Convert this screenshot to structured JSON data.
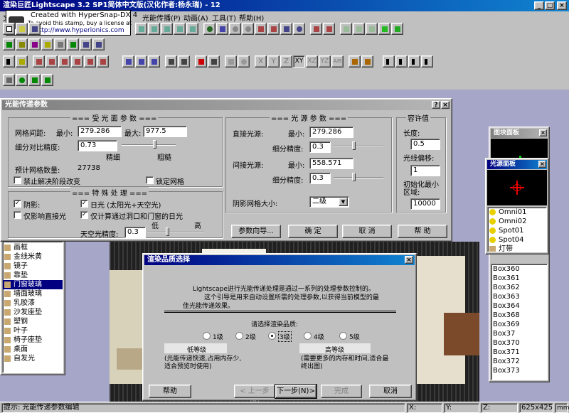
{
  "app": {
    "title": "渲染巨匠Lightscape 3.2 SP1简体中文版(汉化作者:杨永瑞) - 12"
  },
  "menu": {
    "file": "文",
    "lightprop": "光能传播(P)",
    "animation": "动画(A)",
    "tools": "工具(T)",
    "help": "帮助(H)"
  },
  "watermark": {
    "line1": "Created with HyperSnap-DX 4",
    "line2": "To avoid this stamp, buy a license at",
    "line3": "http://www.hyperionics.com"
  },
  "toolbar": {
    "x": "X",
    "y": "Y",
    "z": "Z",
    "xy": "XY",
    "xz": "XZ",
    "yz": "YZ",
    "ab": "A/B"
  },
  "param_dialog": {
    "title": "光能传递参数",
    "receive_section": "=== 受 光 面 参 数 ===",
    "mesh_spacing": "网格间距:",
    "min_label": "最小:",
    "min_value": "279.286",
    "max_label": "最大:",
    "max_value": "977.5",
    "subdiv_contrast": "细分对比精度:",
    "subdiv_value": "0.73",
    "fine": "精细",
    "coarse": "粗糙",
    "est_mesh": "预计网格数量:",
    "est_mesh_value": "27738",
    "disable_change": "禁止解决阶段改变",
    "lock_mesh": "锁定网格",
    "special_section": "=== 特 殊 处 理 ===",
    "shadow": "阴影:",
    "only_direct": "仅影响直接光",
    "daylight": "日光 (太阳光+天空光)",
    "only_windows": "仅计算通过洞口和门窗的日光",
    "low": "低",
    "high": "高",
    "sky_precision": "天空光精度:",
    "sky_value": "0.3",
    "source_section": "=== 光 源 参 数 ===",
    "direct_src": "直接光源:",
    "direct_min_label": "最小:",
    "direct_min": "279.286",
    "direct_subdiv_label": "细分精度:",
    "direct_subdiv": "0.3",
    "indirect_src": "间接光源:",
    "indirect_min_label": "最小:",
    "indirect_min": "558.571",
    "indirect_subdiv_label": "细分精度:",
    "indirect_subdiv": "0.3",
    "shadow_mesh": "阴影网格大小:",
    "shadow_mesh_value": "二级",
    "tolerance_section": "容许值",
    "length": "长度:",
    "length_value": "0.5",
    "ray_offset": "光线偏移:",
    "ray_offset_value": "1",
    "init_min": "初始化最小",
    "init_area": "区域:",
    "init_value": "10000",
    "wizard_btn": "参数向导...",
    "ok_btn": "确 定",
    "cancel_btn": "取 消",
    "help_btn": "帮 助"
  },
  "quality_dialog": {
    "title": "渲染品质选择",
    "intro1": "Lightscape进行光能传递处理是通过一系列的处理参数控制的。",
    "intro2": "这个引导是用来自动设置所需的处理参数,以获得当前模型的最",
    "intro3": "佳光能传递效果。",
    "prompt": "请选择渲染品质:",
    "levels": [
      "1级",
      "2级",
      "3级",
      "4级",
      "5级"
    ],
    "selected": "3级",
    "low_title": "低等级",
    "low_desc1": "(光能传递快速,占用内存少,",
    "low_desc2": "适合预览时使用)",
    "high_title": "高等级",
    "high_desc1": "(需要更多的内存和时间,适合最",
    "high_desc2": "终出图)",
    "help": "帮助",
    "back": "< 上一步(B)",
    "next": "下一步(N)>",
    "finish": "完成",
    "cancel": "取消"
  },
  "material_list": {
    "items": [
      "画框",
      "金线米黄",
      "镜子",
      "靠垫",
      "门窗玻璃",
      "墙面玻璃",
      "乳胶漆",
      "沙发座垫",
      "塑钢",
      "叶子",
      "椅子座垫",
      "桌面",
      "自发光"
    ],
    "selected": "门窗玻璃"
  },
  "block_panel": {
    "title": "图块面板",
    "items": [
      "Box360",
      "Box361",
      "Box362",
      "Box363",
      "Box364",
      "Box368",
      "Box369",
      "Box37",
      "Box370",
      "Box371",
      "Box372",
      "Box373"
    ]
  },
  "light_panel": {
    "title": "光源面板",
    "items": [
      "Omni01",
      "Omni02",
      "Spot01",
      "Spot04",
      "灯带"
    ]
  },
  "status": {
    "text": "提示: 光能传递参数编辑",
    "x": "X:",
    "y": "Y:",
    "z": "Z:",
    "size": "625x425",
    "dim": "mm"
  }
}
